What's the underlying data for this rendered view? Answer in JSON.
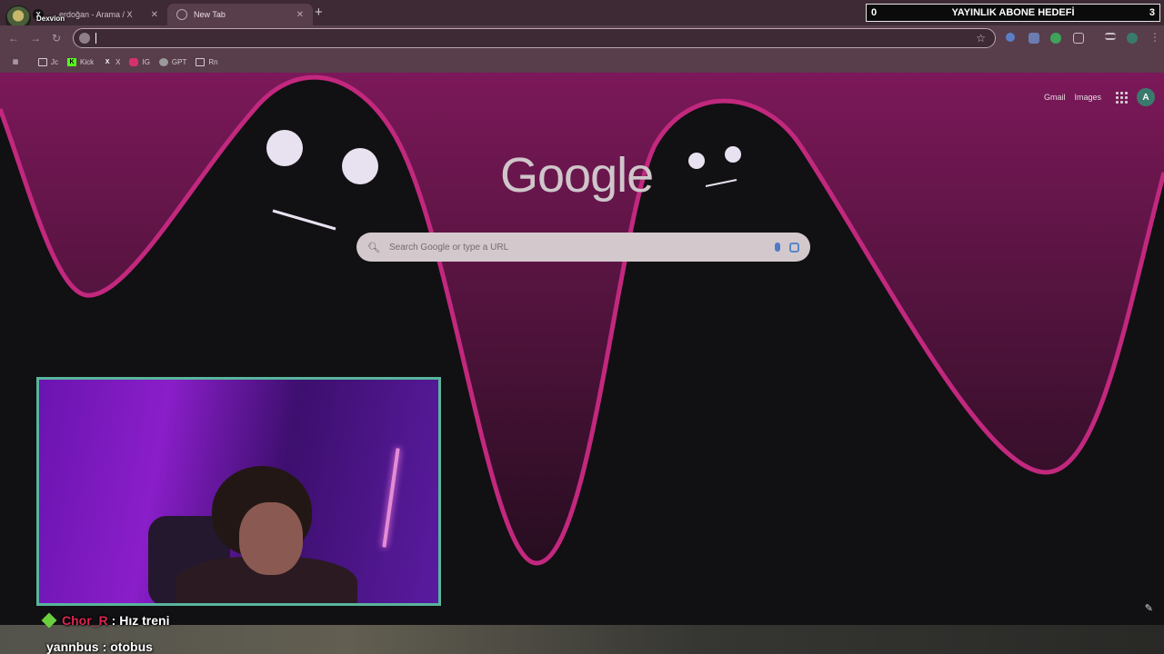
{
  "tabs": [
    {
      "label": "... erdoğan - Arama / X",
      "icon": "x-icon",
      "active": false
    },
    {
      "label": "New Tab",
      "icon": "globe-icon",
      "active": true
    }
  ],
  "streamer": {
    "name": "Dexvion"
  },
  "goal": {
    "current": "0",
    "label": "YAYINLIK ABONE HEDEFİ",
    "target": "3"
  },
  "omnibox": {
    "value": "",
    "placeholder": ""
  },
  "bookmarks": [
    {
      "label": "Jc",
      "icon": "folder-icon"
    },
    {
      "label": "Kick",
      "icon": "kick-icon"
    },
    {
      "label": "X",
      "icon": "x-icon"
    },
    {
      "label": "IG",
      "icon": "instagram-icon"
    },
    {
      "label": "GPT",
      "icon": "chatgpt-icon"
    },
    {
      "label": "Rn",
      "icon": "folder-icon"
    }
  ],
  "google": {
    "logo": "Google",
    "links": {
      "gmail": "Gmail",
      "images": "Images"
    },
    "account_initial": "A",
    "search_placeholder": "Search Google or type a URL"
  },
  "chat": [
    {
      "user": "Chor_R",
      "message": "Hız treni"
    },
    {
      "user": "yannbus",
      "message": "otobus"
    }
  ],
  "colors": {
    "accent": "#c2287e",
    "webcam_border": "#59b59c",
    "chrome": "#573e4a"
  }
}
